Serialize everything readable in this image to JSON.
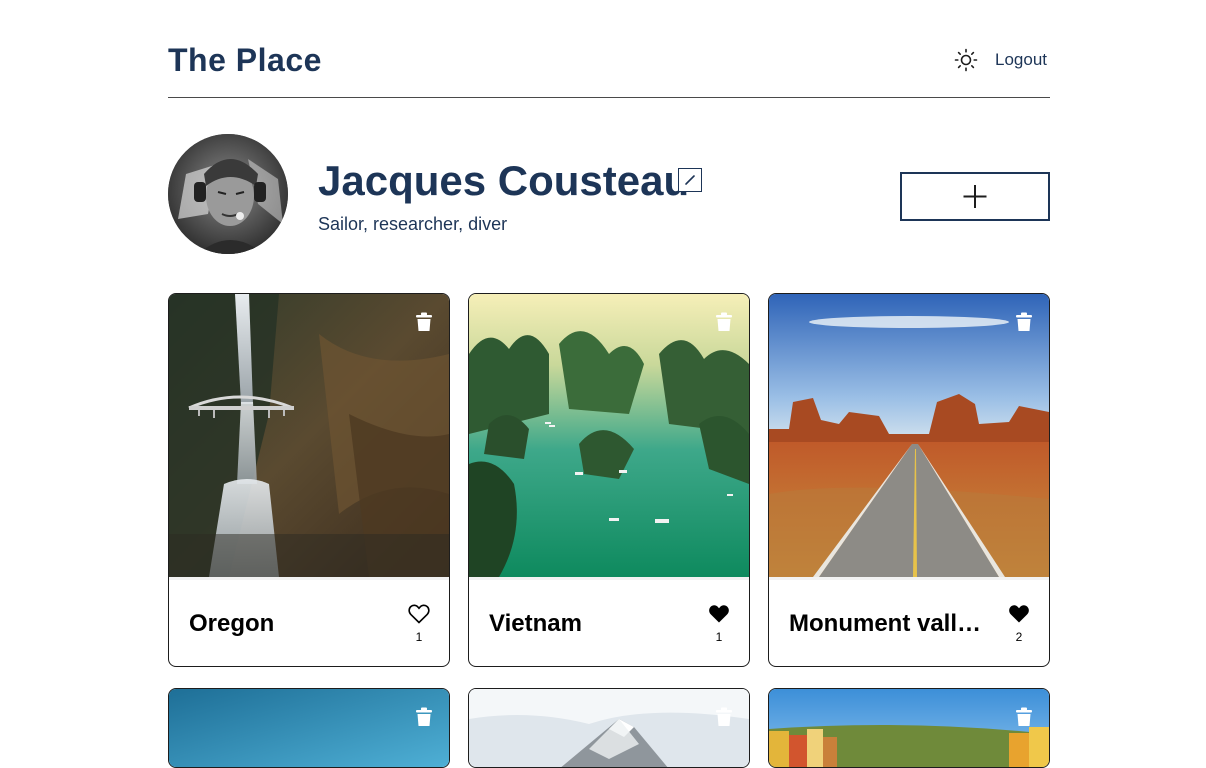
{
  "header": {
    "logo": "The Place",
    "theme_icon": "sun-icon",
    "logout_label": "Logout"
  },
  "profile": {
    "name": "Jacques Cousteau",
    "about": "Sailor, researcher, diver",
    "edit_icon": "pencil-icon",
    "add_icon": "plus-icon"
  },
  "cards": [
    {
      "title": "Oregon",
      "likes": "1",
      "liked": false
    },
    {
      "title": "Vietnam",
      "likes": "1",
      "liked": true
    },
    {
      "title": "Monument valley, Utah",
      "likes": "2",
      "liked": true
    },
    {
      "title": "",
      "likes": "",
      "liked": false
    },
    {
      "title": "",
      "likes": "",
      "liked": false
    },
    {
      "title": "",
      "likes": "",
      "liked": false
    }
  ],
  "colors": {
    "text": "#1d3557",
    "border": "#1d1d1d",
    "heart": "#000000"
  }
}
